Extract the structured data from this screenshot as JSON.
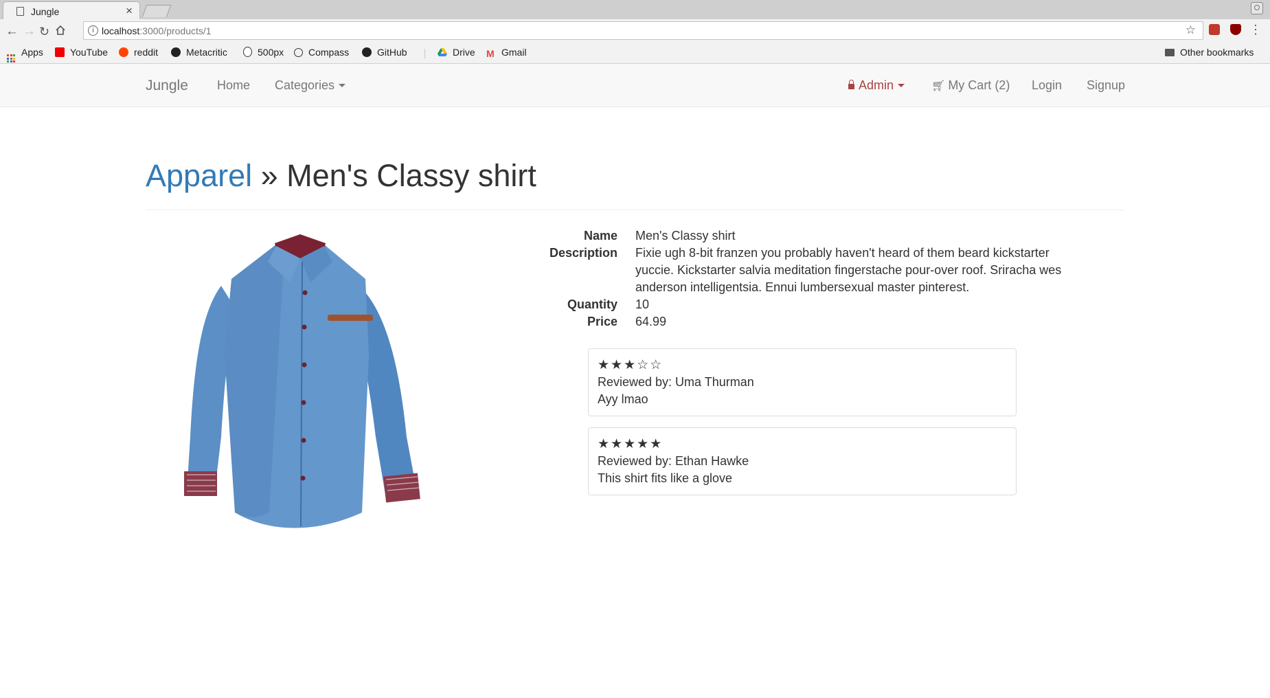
{
  "browser": {
    "tab_title": "Jungle",
    "url_host": "localhost",
    "url_path": ":3000/products/1",
    "bookmarks": [
      "Apps",
      "YouTube",
      "reddit",
      "Metacritic",
      "500px",
      "Compass",
      "GitHub",
      "Drive",
      "Gmail"
    ],
    "other_bookmarks": "Other bookmarks"
  },
  "navbar": {
    "brand": "Jungle",
    "home": "Home",
    "categories": "Categories",
    "admin": "Admin",
    "cart": "My Cart (2)",
    "login": "Login",
    "signup": "Signup"
  },
  "product": {
    "category": "Apparel",
    "separator": "»",
    "name": "Men's Classy shirt",
    "labels": {
      "name": "Name",
      "description": "Description",
      "quantity": "Quantity",
      "price": "Price"
    },
    "description": "Fixie ugh 8-bit franzen you probably haven't heard of them beard kickstarter yuccie. Kickstarter salvia meditation fingerstache pour-over roof. Sriracha wes anderson intelligentsia. Ennui lumbersexual master pinterest.",
    "quantity": "10",
    "price": "64.99"
  },
  "reviews": [
    {
      "stars": "★★★☆☆",
      "rating": 3,
      "reviewer": "Reviewed by: Uma Thurman",
      "text": "Ayy lmao"
    },
    {
      "stars": "★★★★★",
      "rating": 5,
      "reviewer": "Reviewed by: Ethan Hawke",
      "text": "This shirt fits like a glove"
    }
  ],
  "colors": {
    "link": "#337ab7",
    "admin": "#a94442",
    "navbar_bg": "#f8f8f8"
  }
}
